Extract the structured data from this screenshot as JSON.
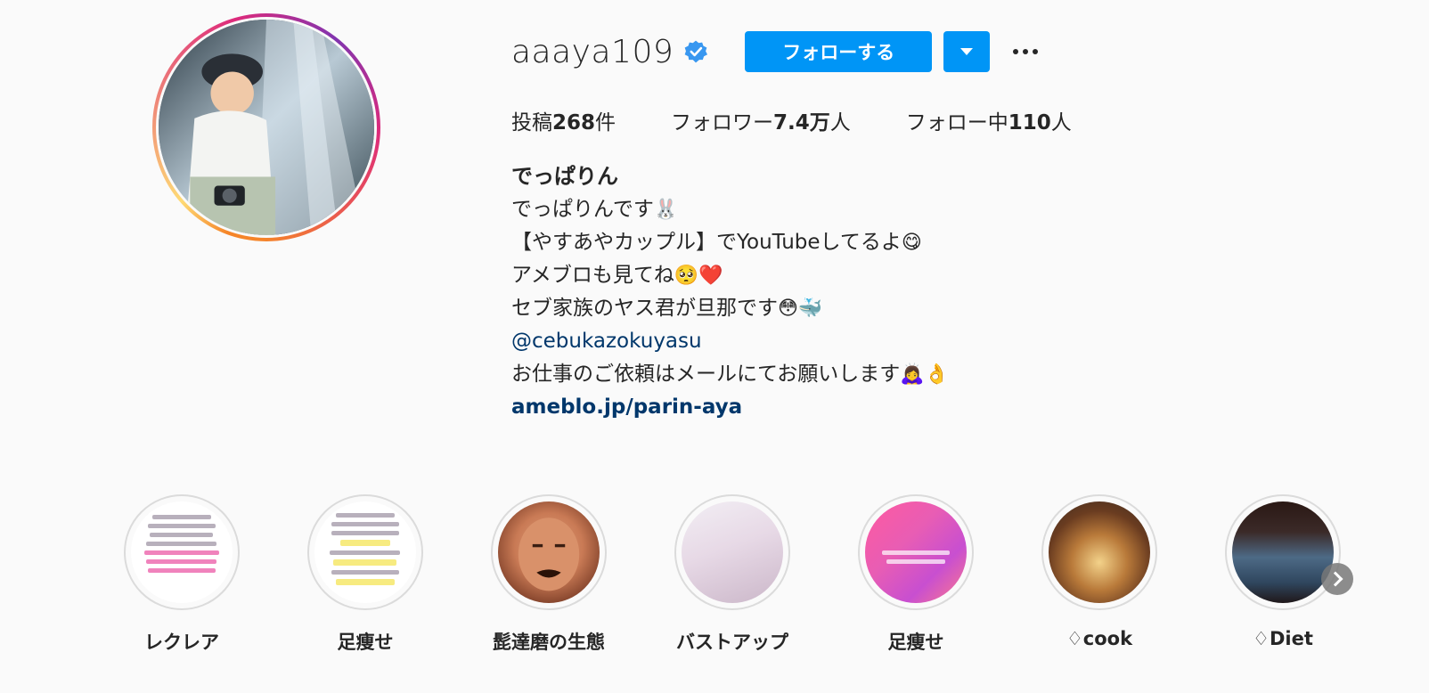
{
  "profile": {
    "username": "aaaya109",
    "verified_icon": "verified-badge-icon",
    "follow_label": "フォローする",
    "dropdown_icon": "caret-down-icon",
    "more_icon": "more-options-icon"
  },
  "stats": {
    "posts_prefix": "投稿",
    "posts_count": "268",
    "posts_suffix": "件",
    "followers_prefix": "フォロワー",
    "followers_count": "7.4万",
    "followers_suffix": "人",
    "following_prefix": "フォロー中",
    "following_count": "110",
    "following_suffix": "人"
  },
  "bio": {
    "name": "でっぱりん",
    "line1": "でっぱりんです",
    "line1_emoji": "🐰",
    "line2": "【やすあやカップル】でYouTubeしてるよ",
    "line2_emoji": "😋",
    "line3": "アメブロも見てね",
    "line3_emoji": "🥺❤️",
    "line4": "セブ家族のヤス君が旦那です",
    "line4_emoji": "😳🐳",
    "mention": "@cebukazokuyasu",
    "line5": "お仕事のご依頼はメールにてお願いします",
    "line5_emoji": "🙇‍♀️👌",
    "link": "ameblo.jp/parin-aya"
  },
  "highlights": [
    {
      "label": "レクレア"
    },
    {
      "label": "足痩せ"
    },
    {
      "label": "髭達磨の生態"
    },
    {
      "label": "バストアップ"
    },
    {
      "label": "足痩せ"
    },
    {
      "label": "♢cook"
    },
    {
      "label": "♢Diet"
    }
  ],
  "next_icon": "chevron-right-icon",
  "colors": {
    "primary": "#0095f6",
    "text": "#262626",
    "link": "#00376b",
    "background": "#fafafa"
  }
}
